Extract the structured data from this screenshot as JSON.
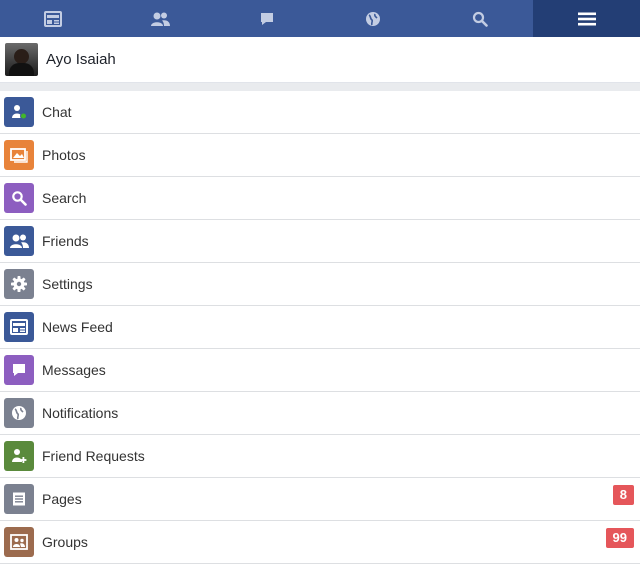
{
  "topbar": {
    "tabs": [
      {
        "icon": "news-feed-icon",
        "active": false
      },
      {
        "icon": "friends-icon",
        "active": false
      },
      {
        "icon": "messages-icon",
        "active": false
      },
      {
        "icon": "globe-icon",
        "active": false
      },
      {
        "icon": "search-icon",
        "active": false
      },
      {
        "icon": "menu-icon",
        "active": true
      }
    ],
    "bar_color": "#3b5998",
    "active_color": "#233e75"
  },
  "profile": {
    "name": "Ayo Isaiah"
  },
  "menu": {
    "items": [
      {
        "label": "Chat",
        "icon": "chat-icon",
        "color": "#3b5998"
      },
      {
        "label": "Photos",
        "icon": "photos-icon",
        "color": "#e8833a"
      },
      {
        "label": "Search",
        "icon": "search-icon",
        "color": "#8d5ec0"
      },
      {
        "label": "Friends",
        "icon": "friends-icon",
        "color": "#3b5998"
      },
      {
        "label": "Settings",
        "icon": "gear-icon",
        "color": "#7b8190"
      },
      {
        "label": "News Feed",
        "icon": "news-feed-icon",
        "color": "#3b5998"
      },
      {
        "label": "Messages",
        "icon": "messages-icon",
        "color": "#8d5ec0"
      },
      {
        "label": "Notifications",
        "icon": "globe-icon",
        "color": "#7b8190"
      },
      {
        "label": "Friend Requests",
        "icon": "friend-request-icon",
        "color": "#5a8a3c"
      },
      {
        "label": "Pages",
        "icon": "pages-icon",
        "color": "#7b8190",
        "badge": "8"
      },
      {
        "label": "Groups",
        "icon": "groups-icon",
        "color": "#9c6b4e",
        "badge": "99"
      }
    ]
  }
}
